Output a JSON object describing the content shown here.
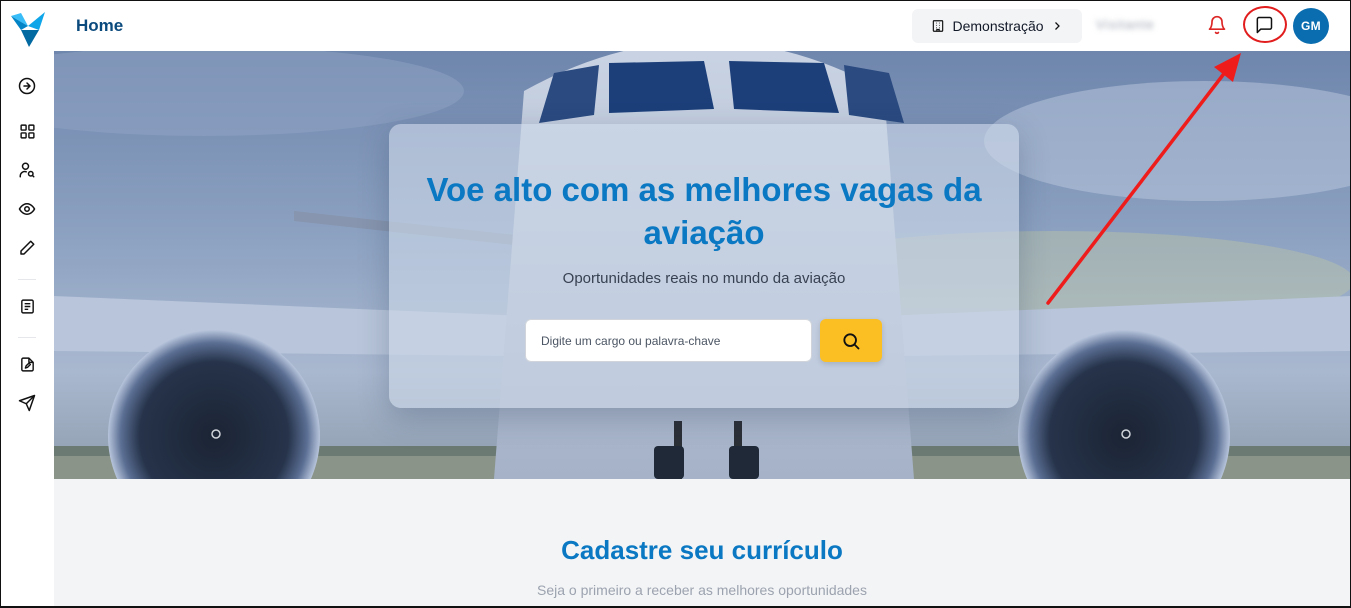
{
  "header": {
    "page_title": "Home",
    "company_label": "Demonstração",
    "user_name": "Visitante",
    "avatar_initials": "GM"
  },
  "hero": {
    "title": "Voe alto com as melhores vagas da aviação",
    "subtitle": "Oportunidades reais no mundo da aviação",
    "search_placeholder": "Digite um cargo ou palavra-chave"
  },
  "section": {
    "title": "Cadastre seu currículo",
    "subtitle": "Seja o primeiro a receber as melhores oportunidades"
  },
  "sidebar_icons": [
    "arrow-right-circle-icon",
    "grid-icon",
    "user-search-icon",
    "eye-icon",
    "pencil-icon",
    "document-icon",
    "file-edit-icon",
    "send-icon"
  ],
  "colors": {
    "brand": "#0a78c2",
    "header_title": "#0b4a7d",
    "search_button": "#fbbf24",
    "notification": "#dc2626",
    "annotation": "#e11d1d"
  }
}
